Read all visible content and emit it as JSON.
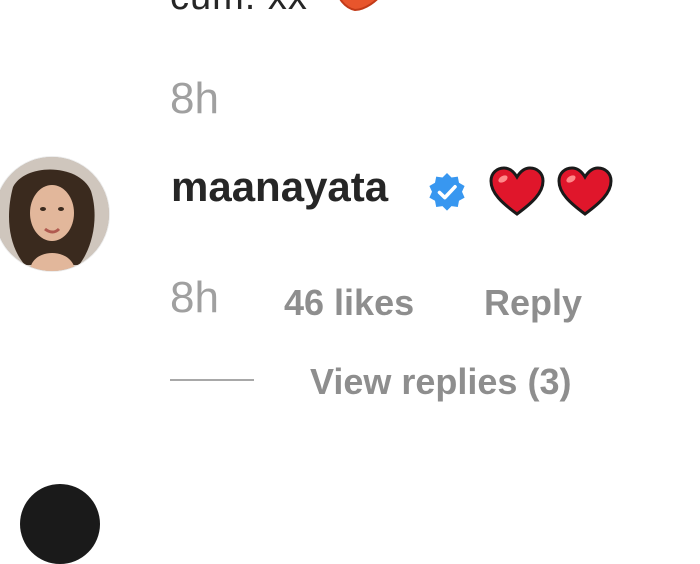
{
  "previous_comment": {
    "text": "cum. xx",
    "emoji_icon": "kiss-lips-icon",
    "time": "8h"
  },
  "comment": {
    "username": "maanayata",
    "verified_icon": "verified-badge-icon",
    "text_icons": [
      "red-heart-icon",
      "red-heart-icon"
    ],
    "time": "8h",
    "likes": "46 likes",
    "reply_label": "Reply",
    "view_replies_label": "View replies (3)"
  },
  "colors": {
    "primary_text": "#262626",
    "secondary_text": "#8e8e8e",
    "verified_blue": "#3897f0",
    "heart_red": "#e0162b"
  }
}
